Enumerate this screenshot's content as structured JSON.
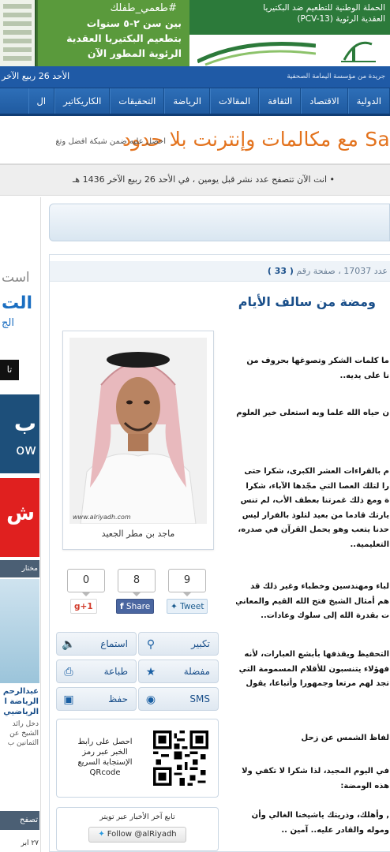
{
  "banner": {
    "hashtag": "#طعمي_طفلك",
    "subtitle_line1": "بين سن ٢-٥ سنوات",
    "subtitle_line2": "بتطعيم البكتيريا العقدية",
    "subtitle_line3": "الرئوية المطور الآن",
    "campaign_line1": "الحملة الوطنية للتطعيم ضد البكتيريا",
    "campaign_line2": "العقدية الرئوية (PCV-13)"
  },
  "datebar": {
    "date": "الأحد 26 ربيع الآخر",
    "tagline": "جريدة من مؤسسة اليمامة الصحفية"
  },
  "nav": {
    "items": [
      "الدولية",
      "الاقتصاد",
      "الثقافة",
      "المقالات",
      "الرياضة",
      "التحقيقات",
      "الكاريكاتير",
      "ال"
    ]
  },
  "ad": {
    "headline": "Sa مع مكالمات وإنترنت بلا حدود",
    "subtext": "احصل عليه ضمن شبكة أفضل وتغ"
  },
  "ticker": {
    "text": "• انت الآن تتصفح عدد نشر قبل يومين ، في الأحد 26 ربيع الآخر 1436 هـ"
  },
  "sidebar": {
    "title1": "است",
    "title2": "الت",
    "title3": "الج",
    "black_tab": "تا",
    "blue_ad_line1": "ب",
    "blue_ad_line2": "ow",
    "red_ad": "ش",
    "section_head": "مختار",
    "news_title": "عبدالرحم الرياضة ا الرياضيي",
    "news_body": "دخل رائد الشيخ عن الثمانين ب",
    "footer_head": "تصفح",
    "footer_sub": "٢٧ ابر"
  },
  "article": {
    "meta_prefix": "عدد 17037 ، صفحة رقم",
    "page_number": "( 33 )",
    "headline": "ومضة من سالف الأيام",
    "paragraphs": [
      [
        "ما كلمات الشكر وتصوغها بحروف من",
        "نا على يديه.."
      ],
      [
        "ن حياه الله علما وبه استعلى خير العلوم"
      ],
      [
        "م بالقراءات العشر الكبرى، شكرا حتى",
        "را لتلك العصا التي مجّدها الآباء، شكرا",
        "ة ومع ذلك غمرتنا بعطف الأب، لم تنس",
        "يارتك قادما من بعيد لتلوذ بالفرار ليس",
        "حدنا يتعب وهو يحمل القرآن في صدره،",
        "التعليمية.."
      ],
      [
        "لباء ومهندسين وخطباء وغير ذلك قد",
        "هم أمثال الشيخ فتح الله القيم والمعاني",
        "ت بقدرة الله إلى سلوك وعادات.."
      ],
      [
        "التحفيظ ويقذفها بأبشع العبارات، لأنه",
        "فهؤلاء يتنسبون للأقلام المسمومة التي",
        "تجد لهم مرتعا وجمهورا وأتباعا، يقول"
      ],
      [
        "لفاظ الشمس عن زحل"
      ],
      [
        "في اليوم المجيد، لذا شكرا لا تكفي ولا",
        "هذه الومضة:"
      ],
      [
        ", وأهلك، وذريتك ياشيخنا الغالي وأن",
        "وموله والقادر عليه.. آمين .."
      ]
    ],
    "photo_url": "www.alriyadh.com",
    "photo_caption": "ماجد بن مطر الجعيد"
  },
  "share": {
    "twitter_count": "9",
    "twitter_label": "Tweet",
    "facebook_count": "8",
    "facebook_label": "Share",
    "gplus_count": "0",
    "gplus_label": "g+1"
  },
  "tools": {
    "zoom": "تكبير",
    "listen": "استماع",
    "favorite": "مفضلة",
    "print": "طباعة",
    "sms": "SMS",
    "save": "حفظ"
  },
  "qr": {
    "line1": "احصل على رابط",
    "line2": "الخبر عبر رمز",
    "line3": "الإستجابة السريع",
    "line4": "QRcode"
  },
  "follow": {
    "text": "تابع آخر الأخبار عبر تويتر",
    "button": "Follow @alRiyadh"
  },
  "colors": {
    "brand_blue": "#1f5aa6",
    "headline_blue": "#1a4f8a",
    "ad_orange": "#e3731e",
    "banner_green": "#2c7a3a"
  }
}
